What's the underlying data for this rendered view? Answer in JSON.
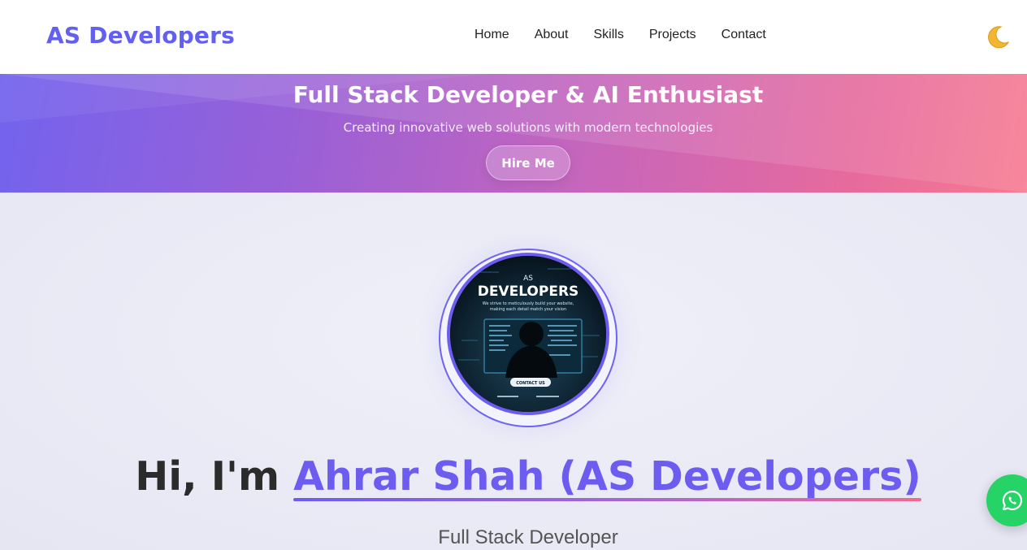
{
  "brand": {
    "name": "AS Developers",
    "accent": "#6360f0"
  },
  "nav": {
    "items": [
      "Home",
      "About",
      "Skills",
      "Projects",
      "Contact"
    ],
    "theme_toggle_icon": "moon-icon"
  },
  "banner": {
    "title": "Full Stack Developer & AI Enthusiast",
    "subtitle": "Creating innovative web solutions with modern technologies",
    "cta_label": "Hire Me",
    "gradient": [
      "#7363ee",
      "#c766bb",
      "#f77a90"
    ]
  },
  "profile_image": {
    "small_text": "AS",
    "title": "DEVELOPERS",
    "line1": "We strive to meticulously build your website,",
    "line2": "making each detail match your vision",
    "button": "CONTACT US"
  },
  "hero": {
    "greeting": "Hi, I'm ",
    "name": "Ahrar Shah (AS Developers)",
    "role": "Full Stack Developer"
  },
  "floating": {
    "whatsapp_icon": "whatsapp-icon",
    "color": "#25d366"
  }
}
